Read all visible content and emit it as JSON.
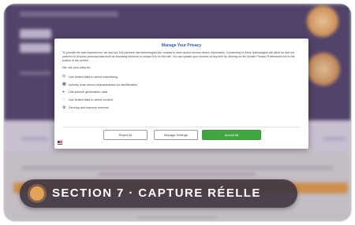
{
  "consent_modal": {
    "title": "Manage Your Privacy",
    "intro": "To provide the best experiences, we and our 146 partners use technologies like cookies to store and/or access device information. Consenting to these technologies will allow us and our partners to process personal data such as browsing behavior or unique IDs on this site. You can update your choices at any time by clicking on the Update Privacy Preferences link in the bottom of the screen.",
    "use_data_label": "We use your data for:",
    "purposes": [
      {
        "icon": "target-icon",
        "label": "Use limited data to select advertising"
      },
      {
        "icon": "scan-icon",
        "label": "Actively scan device characteristics for identification"
      },
      {
        "icon": "location-icon",
        "label": "Use precise geolocation data"
      },
      {
        "icon": "heart-icon",
        "label": "Use limited data to select content"
      },
      {
        "icon": "tools-icon",
        "label": "Develop and improve services"
      }
    ],
    "buttons": {
      "reject": "Reject All",
      "settings": "Manage Settings",
      "accept": "Accept All"
    },
    "accept_color": "#41a541",
    "title_color": "#2f5bb7"
  },
  "caption": {
    "text": "SECTION 7 · CAPTURE RÉELLE",
    "dot_color": "#e4a356"
  },
  "colors": {
    "hero_background": "#574870",
    "orange_bar": "#e3a04f"
  }
}
